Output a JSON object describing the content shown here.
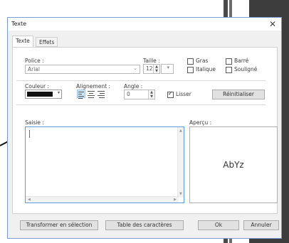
{
  "window": {
    "title": "Texte"
  },
  "tabs": [
    {
      "label": "Texte",
      "active": true
    },
    {
      "label": "Effets",
      "active": false
    }
  ],
  "font": {
    "label": "Police :",
    "value": "Arial"
  },
  "size": {
    "label": "Taille :",
    "value": "12"
  },
  "style_options": [
    {
      "label": "Gras",
      "checked": false
    },
    {
      "label": "Barré",
      "checked": false
    },
    {
      "label": "Italique",
      "checked": false
    },
    {
      "label": "Souligné",
      "checked": false
    }
  ],
  "color": {
    "label": "Couleur :",
    "value": "#111111"
  },
  "alignment": {
    "label": "Alignement :",
    "selected": "left"
  },
  "angle": {
    "label": "Angle :",
    "value": "0"
  },
  "smooth": {
    "label": "Lisser",
    "checked": true
  },
  "reset_button": "Réinitialiser",
  "input": {
    "label": "Saisie :",
    "value": ""
  },
  "preview": {
    "label": "Aperçu :",
    "text": "AbYz"
  },
  "footer": {
    "to_selection": "Transformer en sélection",
    "char_table": "Table des caractères",
    "ok": "Ok",
    "cancel": "Annuler"
  },
  "colors": {
    "accent": "#5aa0e0",
    "selected_bg": "#cce4f7",
    "background_dark": "#3d3d3d"
  }
}
